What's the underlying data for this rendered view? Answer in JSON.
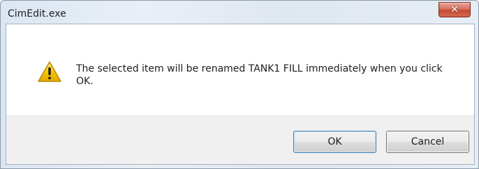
{
  "window": {
    "title": "CimEdit.exe",
    "close_icon": "close-icon",
    "close_glyph": "✕"
  },
  "message": {
    "icon": "warning-icon",
    "text": "The selected item will be renamed TANK1 FILL immediately when you click OK."
  },
  "buttons": {
    "ok_label": "OK",
    "cancel_label": "Cancel"
  },
  "colors": {
    "close_button": "#c44a33",
    "warning_fill": "#f5c400",
    "default_button_border": "#3c7fb1"
  }
}
